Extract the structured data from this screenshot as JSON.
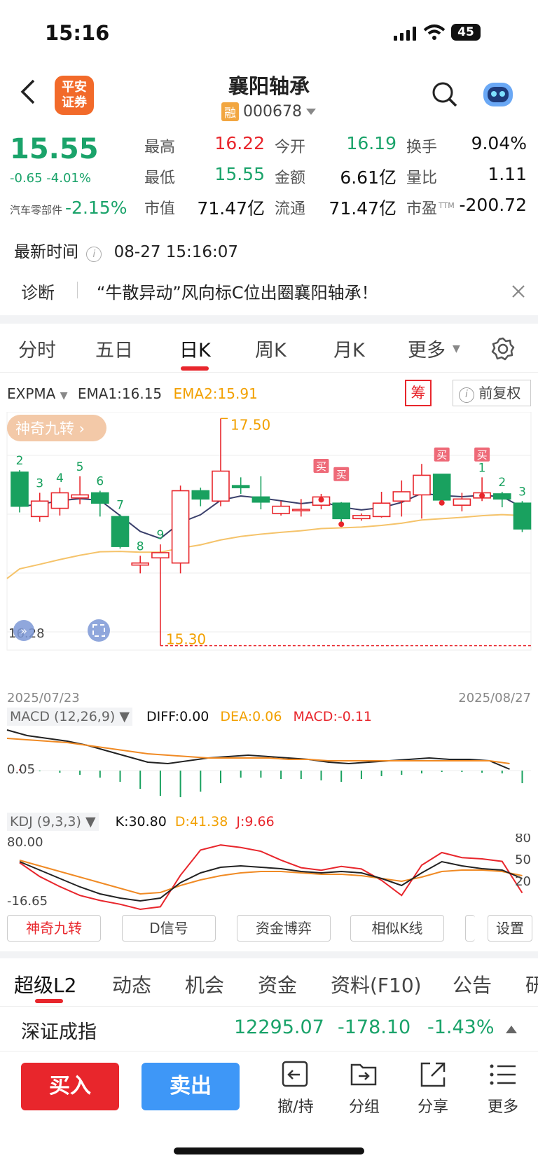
{
  "status": {
    "time": "15:16",
    "battery": "45"
  },
  "header": {
    "title": "襄阳轴承",
    "rong": "融",
    "code": "000678",
    "logo": "平安\n证券"
  },
  "quote": {
    "price": "15.55",
    "change": "-0.65  -4.01%",
    "sector_name": "汽车零部件",
    "sector_change": "-2.15%",
    "grid": [
      {
        "label": "最高",
        "value": "16.22",
        "color": "red"
      },
      {
        "label": "今开",
        "value": "16.19",
        "color": "green"
      },
      {
        "label": "换手",
        "value": "9.04%",
        "color": "dark"
      },
      {
        "label": "最低",
        "value": "15.55",
        "color": "green"
      },
      {
        "label": "金额",
        "value": "6.61亿",
        "color": "dark"
      },
      {
        "label": "量比",
        "value": "1.11",
        "color": "dark"
      },
      {
        "label": "市值",
        "value": "71.47亿",
        "color": "dark"
      },
      {
        "label": "流通",
        "value": "71.47亿",
        "color": "dark"
      },
      {
        "label": "市盈",
        "value": "-200.72",
        "color": "dark",
        "sup": "TTM"
      }
    ],
    "update_label": "最新时间",
    "update_time": "08-27 15:16:07"
  },
  "diagnosis": {
    "label": "诊断",
    "text": "“牛散异动”风向标C位出圈襄阳轴承！"
  },
  "tabs": [
    "分时",
    "五日",
    "日K",
    "周K",
    "月K",
    "更多"
  ],
  "ema": {
    "name": "EXPMA",
    "ema1": "EMA1:16.15",
    "ema2": "EMA2:15.91",
    "chou": "筹",
    "fq": "前复权"
  },
  "kchart": {
    "nine_label": "神奇九转",
    "high_label": "17.50",
    "low_label": "15.30",
    "left_val": "16.28",
    "date_start": "2025/07/23",
    "date_end": "2025/08/27",
    "buy_mark": "买",
    "candles": [
      {
        "o": 16.98,
        "c": 16.65,
        "h": 17.0,
        "l": 16.59,
        "n": "2"
      },
      {
        "o": 16.55,
        "c": 16.7,
        "h": 16.78,
        "l": 16.5,
        "n": "3"
      },
      {
        "o": 16.63,
        "c": 16.78,
        "h": 16.83,
        "l": 16.56,
        "n": "4"
      },
      {
        "o": 16.73,
        "c": 16.76,
        "h": 16.94,
        "l": 16.67,
        "n": "5"
      },
      {
        "o": 16.78,
        "c": 16.68,
        "h": 16.8,
        "l": 16.55,
        "n": "6"
      },
      {
        "o": 16.55,
        "c": 16.26,
        "h": 16.57,
        "l": 16.24,
        "n": "7"
      },
      {
        "o": 16.08,
        "c": 16.1,
        "h": 16.17,
        "l": 16.0,
        "n": "8"
      },
      {
        "o": 16.15,
        "c": 16.2,
        "h": 16.28,
        "l": 15.3,
        "n": "9"
      },
      {
        "o": 16.1,
        "c": 16.8,
        "h": 16.85,
        "l": 16.0,
        "n": ""
      },
      {
        "o": 16.8,
        "c": 16.72,
        "h": 16.83,
        "l": 16.65,
        "n": ""
      },
      {
        "o": 16.7,
        "c": 16.99,
        "h": 17.5,
        "l": 16.65,
        "n": ""
      },
      {
        "o": 16.85,
        "c": 16.83,
        "h": 16.93,
        "l": 16.77,
        "n": ""
      },
      {
        "o": 16.74,
        "c": 16.69,
        "h": 16.94,
        "l": 16.62,
        "n": ""
      },
      {
        "o": 16.58,
        "c": 16.65,
        "h": 16.7,
        "l": 16.56,
        "n": ""
      },
      {
        "o": 16.62,
        "c": 16.62,
        "h": 16.72,
        "l": 16.55,
        "n": ""
      },
      {
        "o": 16.66,
        "c": 16.74,
        "h": 16.77,
        "l": 16.62,
        "n": ""
      },
      {
        "o": 16.68,
        "c": 16.53,
        "h": 16.69,
        "l": 16.48,
        "n": ""
      },
      {
        "o": 16.53,
        "c": 16.56,
        "h": 16.58,
        "l": 16.51,
        "n": ""
      },
      {
        "o": 16.55,
        "c": 16.68,
        "h": 16.79,
        "l": 16.54,
        "n": ""
      },
      {
        "o": 16.7,
        "c": 16.79,
        "h": 16.9,
        "l": 16.55,
        "n": ""
      },
      {
        "o": 16.76,
        "c": 16.95,
        "h": 17.06,
        "l": 16.53,
        "n": ""
      },
      {
        "o": 16.96,
        "c": 16.71,
        "h": 16.96,
        "l": 16.69,
        "n": ""
      },
      {
        "o": 16.66,
        "c": 16.72,
        "h": 16.78,
        "l": 16.6,
        "n": ""
      },
      {
        "o": 16.73,
        "c": 16.78,
        "h": 16.93,
        "l": 16.7,
        "n": "1"
      },
      {
        "o": 16.77,
        "c": 16.72,
        "h": 16.79,
        "l": 16.64,
        "n": "2"
      },
      {
        "o": 16.68,
        "c": 16.43,
        "h": 16.7,
        "l": 16.4,
        "n": "3"
      }
    ]
  },
  "macd": {
    "name": "MACD (12,26,9)",
    "diff": "DIFF:0.00",
    "dea": "DEA:0.06",
    "macd": "MACD:-0.11",
    "axis": "0.05"
  },
  "kdj": {
    "name": "KDJ (9,3,3)",
    "k": "K:30.80",
    "d": "D:41.38",
    "j": "J:9.66",
    "axis_top": "80.00",
    "axis_bottom": "-16.65",
    "r80": "80",
    "r50": "50",
    "r20": "20"
  },
  "tool_buttons": [
    "神奇九转",
    "D信号",
    "资金博弈",
    "相似K线",
    "设置"
  ],
  "bottom_tabs": [
    "超级L2",
    "动态",
    "机会",
    "资金",
    "资料(F10)",
    "公告",
    "研"
  ],
  "index_bar": {
    "name": "深证成指",
    "value": "12295.07",
    "change": "-178.10",
    "pct": "-1.43%"
  },
  "actions": {
    "buy": "买入",
    "sell": "卖出",
    "tools": [
      {
        "label": "撤/持",
        "icon": "undo-icon"
      },
      {
        "label": "分组",
        "icon": "group-icon"
      },
      {
        "label": "分享",
        "icon": "share-icon"
      },
      {
        "label": "更多",
        "icon": "more-icon"
      }
    ]
  }
}
